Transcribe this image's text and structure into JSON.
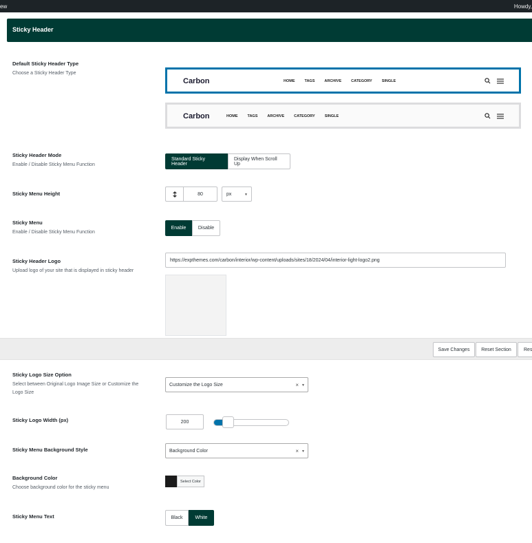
{
  "adminbar": {
    "left_text": "ew",
    "right_text": "Howdy,"
  },
  "section": {
    "title": "Sticky Header"
  },
  "fields": {
    "header_type": {
      "title": "Default Sticky Header Type",
      "desc": "Choose a Sticky Header Type",
      "previews": [
        {
          "logo": "Carbon",
          "menu": [
            "HOME",
            "TAGS",
            "ARCHIVE",
            "CATEGORY",
            "SINGLE"
          ],
          "selected": true
        },
        {
          "logo": "Carbon",
          "menu": [
            "HOME",
            "TAGS",
            "ARCHIVE",
            "CATEGORY",
            "SINGLE"
          ],
          "selected": false
        }
      ]
    },
    "header_mode": {
      "title": "Sticky Header Mode",
      "desc": "Enable / Disable Sticky Menu Function",
      "options": [
        "Standard Sticky Header",
        "Display When Scroll Up"
      ],
      "selected": "Standard Sticky Header"
    },
    "menu_height": {
      "title": "Sticky Menu Height",
      "value": "80",
      "unit": "px"
    },
    "sticky_menu": {
      "title": "Sticky Menu",
      "desc": "Enable / Disable Sticky Menu Function",
      "options": [
        "Enable",
        "Disable"
      ],
      "selected": "Enable"
    },
    "header_logo": {
      "title": "Sticky Header Logo",
      "desc": "Upload logo of your site that is displayed in sticky header",
      "url": "https://expthemes.com/carbon/interior/wp-content/uploads/sites/18/2024/04/interior-light-logo2.png"
    },
    "logo_size": {
      "title": "Sticky Logo Size Option",
      "desc": "Select between Original Logo Image Size or Customize the Logo Size",
      "value": "Customize the Logo Size"
    },
    "logo_width": {
      "title": "Sticky Logo Width (px)",
      "value": "200",
      "slider_fraction": 0.2
    },
    "bg_style": {
      "title": "Sticky Menu Background Style",
      "value": "Background Color"
    },
    "bg_color": {
      "title": "Background Color",
      "desc": "Choose background color for the sticky menu",
      "button": "Select Color",
      "color": "#1b1b1b"
    },
    "menu_text": {
      "title": "Sticky Menu Text",
      "options": [
        "Black",
        "White"
      ],
      "selected": "White"
    }
  },
  "savebar": {
    "save": "Save Changes",
    "reset_section": "Reset Section",
    "reset_all": "Rese"
  },
  "icons": {
    "search": "search-icon",
    "menu": "hamburger-icon",
    "height": "vertical-arrows-icon",
    "clear": "clear-x-icon",
    "dropdown": "caret-down-icon"
  }
}
